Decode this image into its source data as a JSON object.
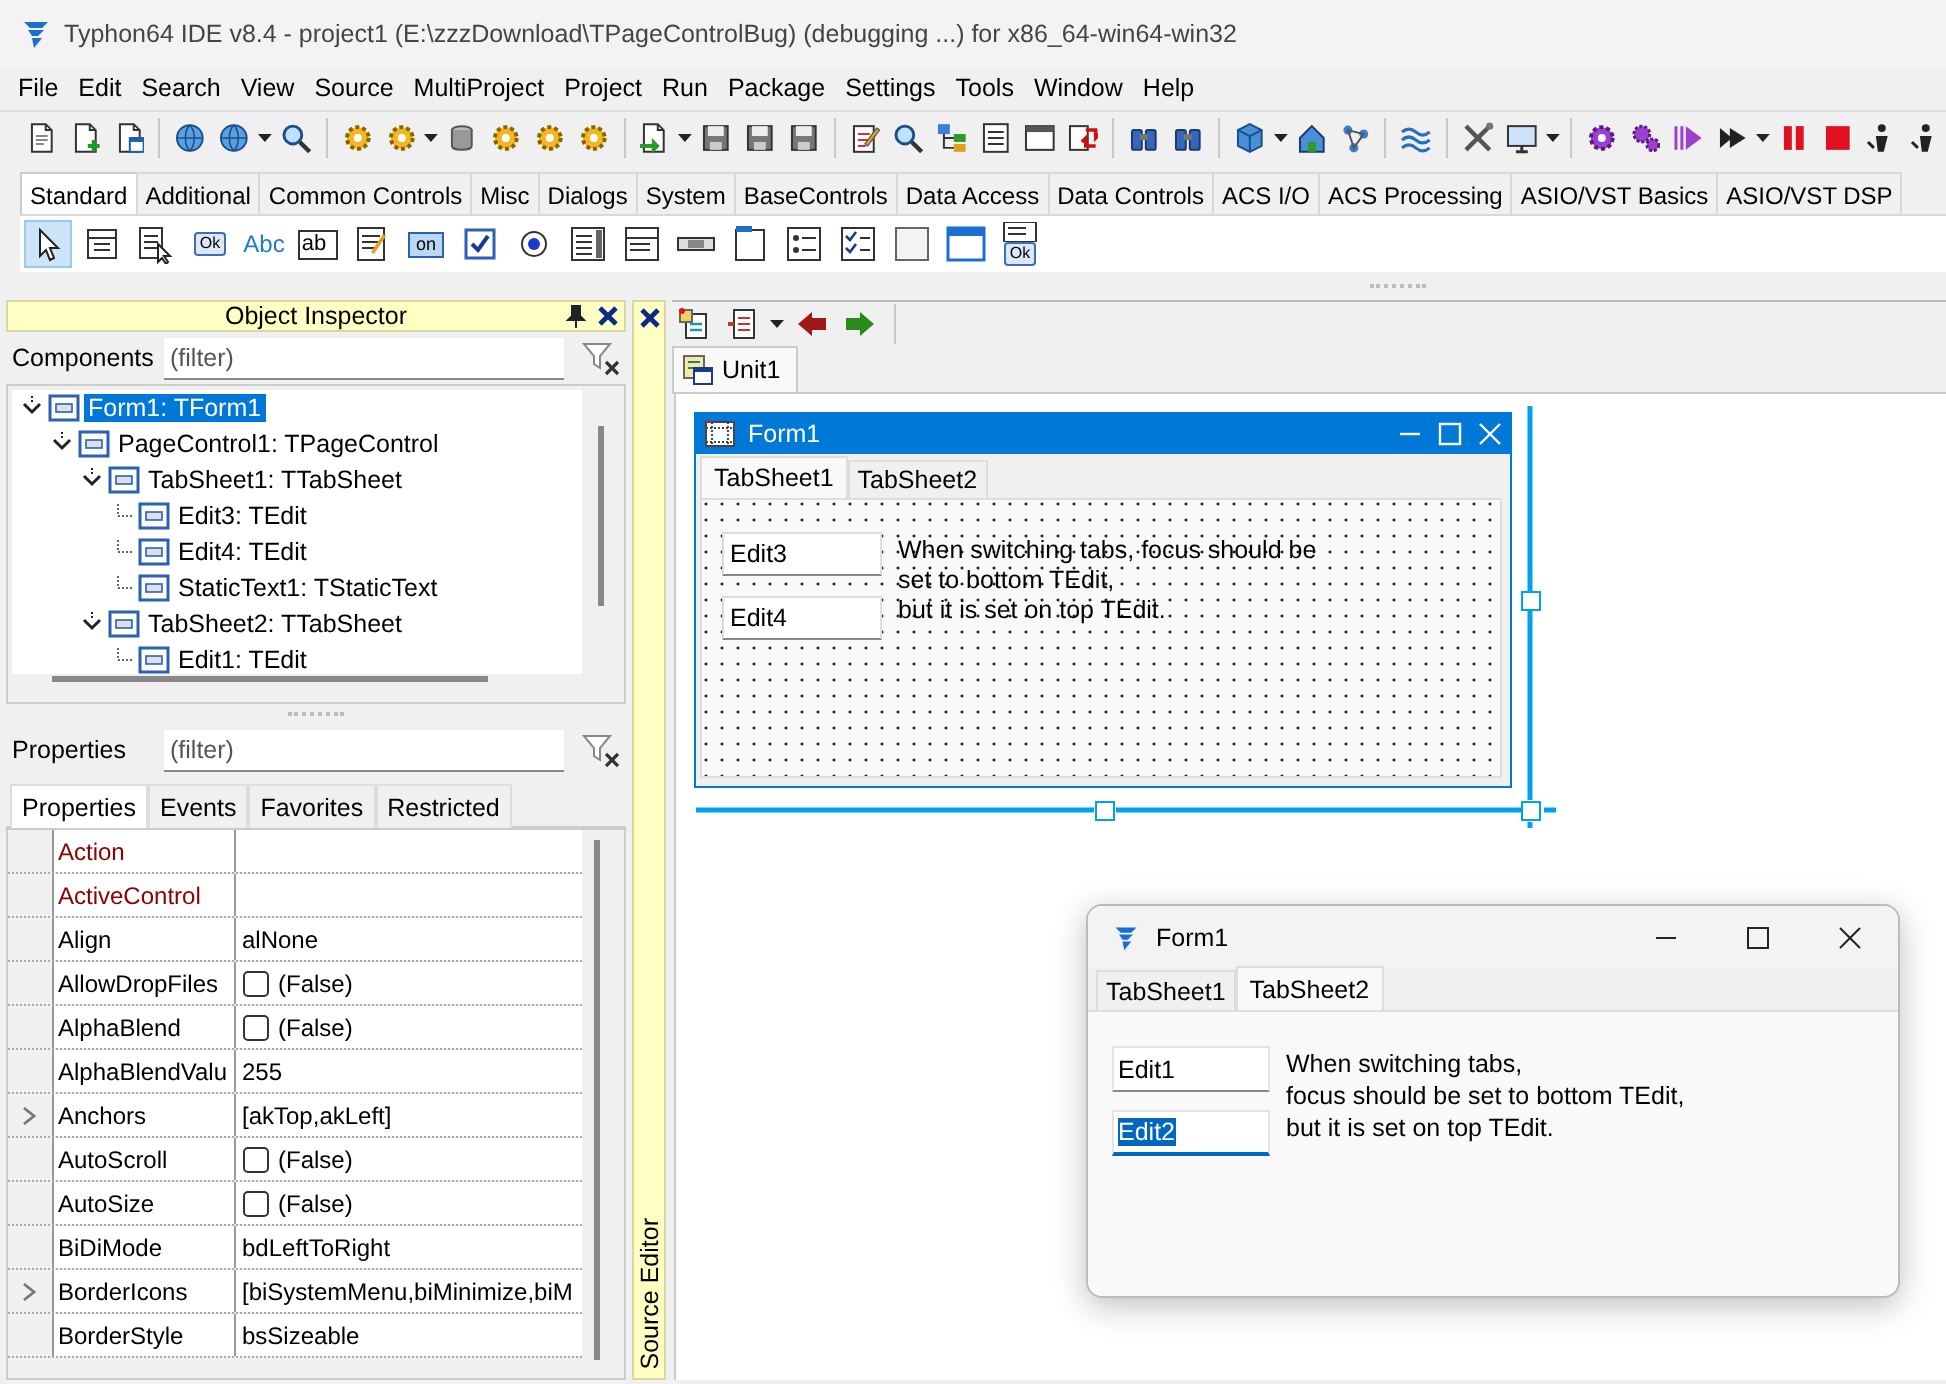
{
  "window": {
    "title": "Typhon64 IDE v8.4 - project1 (E:\\zzzDownload\\TPageControlBug) (debugging ...) for x86_64-win64-win32"
  },
  "menu": [
    "File",
    "Edit",
    "Search",
    "View",
    "Source",
    "MultiProject",
    "Project",
    "Run",
    "Package",
    "Settings",
    "Tools",
    "Window",
    "Help"
  ],
  "palette": {
    "tabs": [
      {
        "label": "Standard",
        "selected": true
      },
      {
        "label": "Additional",
        "selected": false
      },
      {
        "label": "Common Controls",
        "selected": false
      },
      {
        "label": "Misc",
        "selected": false
      },
      {
        "label": "Dialogs",
        "selected": false
      },
      {
        "label": "System",
        "selected": false
      },
      {
        "label": "BaseControls",
        "selected": false
      },
      {
        "label": "Data Access",
        "selected": false
      },
      {
        "label": "Data Controls",
        "selected": false
      },
      {
        "label": "ACS I/O",
        "selected": false
      },
      {
        "label": "ACS Processing",
        "selected": false
      },
      {
        "label": "ASIO/VST Basics",
        "selected": false
      },
      {
        "label": "ASIO/VST DSP",
        "selected": false
      }
    ],
    "items": [
      {
        "kind": "pointer",
        "selected": true
      },
      {
        "kind": "mainmenu",
        "selected": false
      },
      {
        "kind": "popupmenu",
        "selected": false
      },
      {
        "kind": "button",
        "text": "Ok",
        "selected": false
      },
      {
        "kind": "label",
        "text": "Abc",
        "selected": false
      },
      {
        "kind": "edit",
        "text": "ab",
        "selected": false
      },
      {
        "kind": "memo",
        "selected": false
      },
      {
        "kind": "toggle",
        "text": "on",
        "selected": false
      },
      {
        "kind": "checkbox",
        "selected": false
      },
      {
        "kind": "radio",
        "selected": false
      },
      {
        "kind": "listbox",
        "selected": false
      },
      {
        "kind": "combobox",
        "selected": false
      },
      {
        "kind": "scrollbar",
        "selected": false
      },
      {
        "kind": "groupbox",
        "selected": false
      },
      {
        "kind": "radiogroup",
        "selected": false
      },
      {
        "kind": "checkgroup",
        "selected": false
      },
      {
        "kind": "panel",
        "selected": false
      },
      {
        "kind": "frame",
        "selected": false
      },
      {
        "kind": "actionlist",
        "text": "Ok",
        "selected": false
      }
    ]
  },
  "object_inspector": {
    "title": "Object Inspector",
    "components_label": "Components",
    "components_filter": {
      "placeholder": "(filter)"
    },
    "tree": [
      {
        "label": "Form1: TForm1",
        "selected": true,
        "expanded": true,
        "children": [
          {
            "label": "PageControl1: TPageControl",
            "selected": false,
            "expanded": true,
            "children": [
              {
                "label": "TabSheet1: TTabSheet",
                "selected": false,
                "expanded": true,
                "children": [
                  {
                    "label": "Edit3: TEdit",
                    "selected": false
                  },
                  {
                    "label": "Edit4: TEdit",
                    "selected": false
                  },
                  {
                    "label": "StaticText1: TStaticText",
                    "selected": false
                  }
                ]
              },
              {
                "label": "TabSheet2: TTabSheet",
                "selected": false,
                "expanded": true,
                "children": [
                  {
                    "label": "Edit1: TEdit",
                    "selected": false
                  }
                ]
              }
            ]
          }
        ]
      }
    ],
    "properties_label": "Properties",
    "properties_filter": {
      "placeholder": "(filter)"
    },
    "tabs": [
      {
        "label": "Properties",
        "selected": true
      },
      {
        "label": "Events",
        "selected": false
      },
      {
        "label": "Favorites",
        "selected": false
      },
      {
        "label": "Restricted",
        "selected": false
      }
    ],
    "properties": [
      {
        "name": "Action",
        "kind": "ref",
        "expandable": false
      },
      {
        "name": "ActiveControl",
        "kind": "ref",
        "expandable": false
      },
      {
        "name": "Align",
        "kind": "text",
        "value": "alNone",
        "expandable": false
      },
      {
        "name": "AllowDropFiles",
        "kind": "bool",
        "checked": false,
        "value": "(False)",
        "expandable": false
      },
      {
        "name": "AlphaBlend",
        "kind": "bool",
        "checked": false,
        "value": "(False)",
        "expandable": false
      },
      {
        "name": "AlphaBlendValu",
        "kind": "text",
        "value": "255",
        "expandable": false
      },
      {
        "name": "Anchors",
        "kind": "text",
        "value": "[akTop,akLeft]",
        "expandable": true
      },
      {
        "name": "AutoScroll",
        "kind": "bool",
        "checked": false,
        "value": "(False)",
        "expandable": false
      },
      {
        "name": "AutoSize",
        "kind": "bool",
        "checked": false,
        "value": "(False)",
        "expandable": false
      },
      {
        "name": "BiDiMode",
        "kind": "text",
        "value": "bdLeftToRight",
        "expandable": false
      },
      {
        "name": "BorderIcons",
        "kind": "text",
        "value": "[biSystemMenu,biMinimize,biM",
        "expandable": true
      },
      {
        "name": "BorderStyle",
        "kind": "text",
        "value": "bsSizeable",
        "expandable": false
      }
    ]
  },
  "source_editor": {
    "label": "Source Editor"
  },
  "designer": {
    "tabs": [
      {
        "label": "Unit1",
        "selected": true
      }
    ],
    "form": {
      "title": "Form1",
      "tabs": [
        {
          "label": "TabSheet1",
          "selected": true
        },
        {
          "label": "TabSheet2",
          "selected": false
        }
      ],
      "edits": [
        {
          "value": "Edit3"
        },
        {
          "value": "Edit4"
        }
      ],
      "static_text": [
        "When switching tabs, focus should be",
        "set to bottom TEdit,",
        "but it is set on top TEdit."
      ]
    }
  },
  "running_form": {
    "title": "Form1",
    "tabs": [
      {
        "label": "TabSheet1",
        "selected": false
      },
      {
        "label": "TabSheet2",
        "selected": true
      }
    ],
    "edits": [
      {
        "value": "Edit1",
        "focused": false
      },
      {
        "value": "Edit2",
        "focused": true
      }
    ],
    "static_text": [
      "When switching tabs,",
      "focus should be set to bottom TEdit,",
      "but it is set on top TEdit."
    ]
  }
}
